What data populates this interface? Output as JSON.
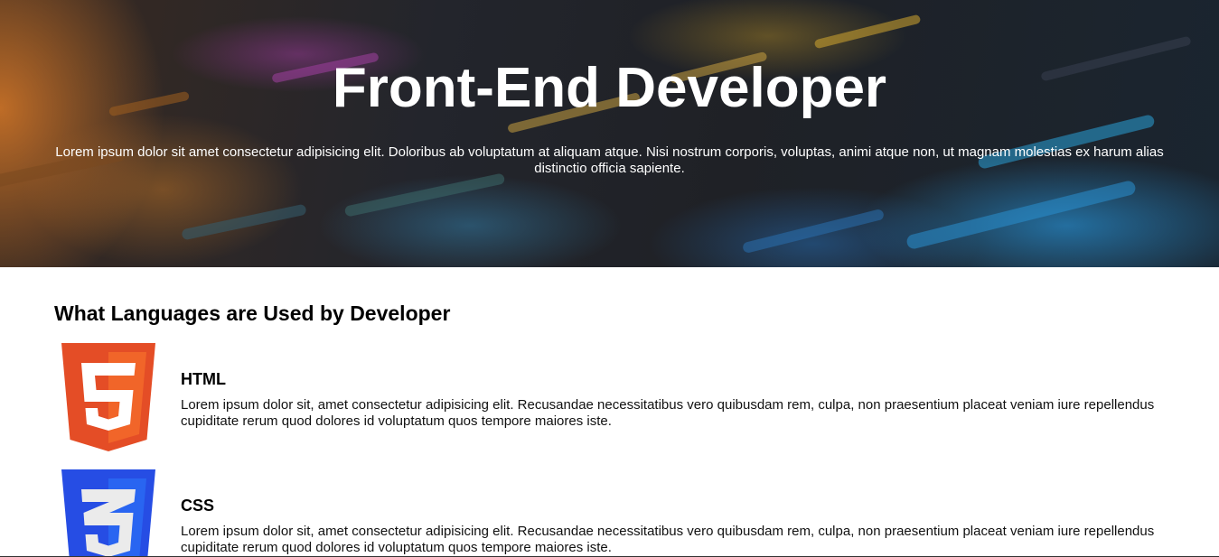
{
  "hero": {
    "title": "Front-End Developer",
    "description": "Lorem ipsum dolor sit amet consectetur adipisicing elit. Doloribus ab voluptatum at aliquam atque. Nisi nostrum corporis, voluptas, animi atque non, ut magnam molestias ex harum alias distinctio officia sapiente."
  },
  "main": {
    "section_title": "What Languages are Used by Developer",
    "languages": [
      {
        "name": "HTML",
        "icon": "html5-icon",
        "color": "#f16529",
        "description": "Lorem ipsum dolor sit, amet consectetur adipisicing elit. Recusandae necessitatibus vero quibusdam rem, culpa, non praesentium placeat veniam iure repellendus cupiditate rerum quod dolores id voluptatum quos tempore maiores iste."
      },
      {
        "name": "CSS",
        "icon": "css3-icon",
        "color": "#2965f1",
        "description": "Lorem ipsum dolor sit, amet consectetur adipisicing elit. Recusandae necessitatibus vero quibusdam rem, culpa, non praesentium placeat veniam iure repellendus cupiditate rerum quod dolores id voluptatum quos tempore maiores iste."
      }
    ]
  }
}
